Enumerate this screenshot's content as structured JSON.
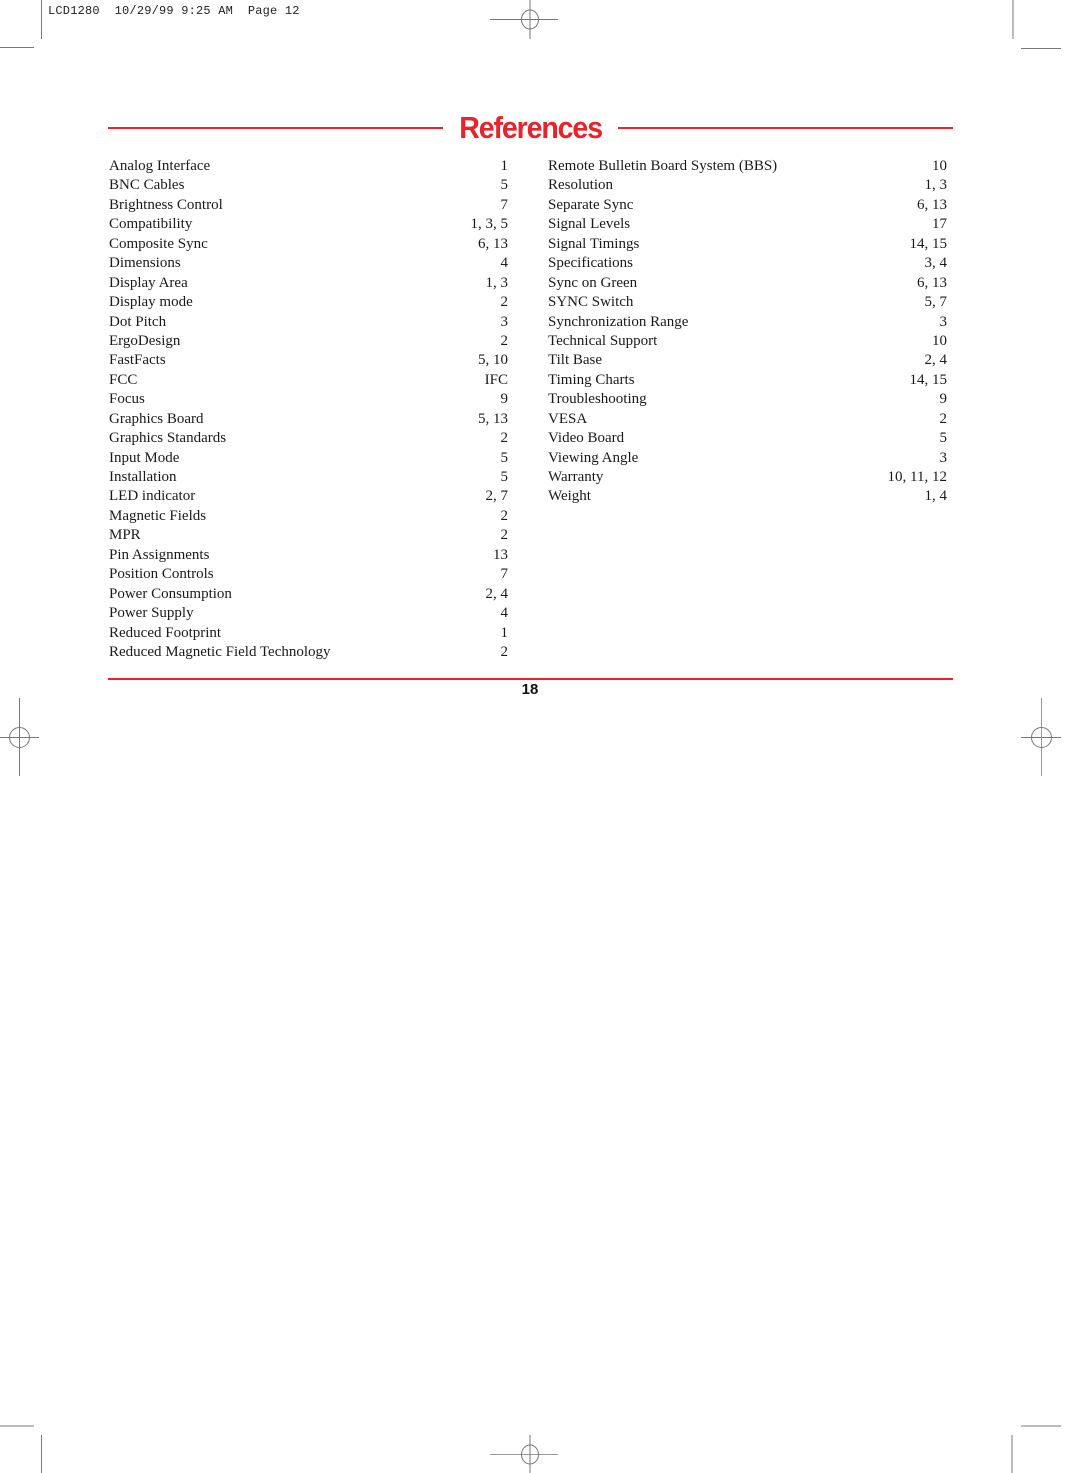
{
  "slug": "LCD1280  10/29/99 9:25 AM  Page 12",
  "title": "References",
  "page_number": "18",
  "accent_color": "#e8232a",
  "left_column": [
    {
      "term": "Analog Interface",
      "pages": "1"
    },
    {
      "term": "BNC Cables",
      "pages": "5"
    },
    {
      "term": "Brightness Control",
      "pages": "7"
    },
    {
      "term": "Compatibility",
      "pages": "1, 3, 5"
    },
    {
      "term": "Composite Sync",
      "pages": "6, 13"
    },
    {
      "term": "Dimensions",
      "pages": "4"
    },
    {
      "term": "Display Area",
      "pages": "1, 3"
    },
    {
      "term": "Display mode",
      "pages": "2"
    },
    {
      "term": "Dot Pitch",
      "pages": "3"
    },
    {
      "term": "ErgoDesign",
      "pages": "2"
    },
    {
      "term": "FastFacts",
      "pages": "5, 10"
    },
    {
      "term": "FCC",
      "pages": "IFC"
    },
    {
      "term": "Focus",
      "pages": "9"
    },
    {
      "term": "Graphics Board",
      "pages": "5, 13"
    },
    {
      "term": "Graphics Standards",
      "pages": "2"
    },
    {
      "term": "Input Mode",
      "pages": "5"
    },
    {
      "term": "Installation",
      "pages": "5"
    },
    {
      "term": "LED indicator",
      "pages": "2, 7"
    },
    {
      "term": "Magnetic Fields",
      "pages": "2"
    },
    {
      "term": "MPR",
      "pages": "2"
    },
    {
      "term": "Pin Assignments",
      "pages": "13"
    },
    {
      "term": "Position Controls",
      "pages": "7"
    },
    {
      "term": "Power Consumption",
      "pages": "2, 4"
    },
    {
      "term": "Power Supply",
      "pages": "4"
    },
    {
      "term": "Reduced Footprint",
      "pages": "1"
    },
    {
      "term": "Reduced Magnetic Field Technology",
      "pages": "2"
    }
  ],
  "right_column": [
    {
      "term": "Remote Bulletin Board System (BBS)",
      "pages": "10"
    },
    {
      "term": "Resolution",
      "pages": "1, 3"
    },
    {
      "term": "Separate Sync",
      "pages": "6, 13"
    },
    {
      "term": "Signal Levels",
      "pages": "17"
    },
    {
      "term": "Signal Timings",
      "pages": "14, 15"
    },
    {
      "term": "Specifications",
      "pages": "3, 4"
    },
    {
      "term": "Sync on Green",
      "pages": "6, 13"
    },
    {
      "term": "SYNC Switch",
      "pages": "5, 7"
    },
    {
      "term": "Synchronization Range",
      "pages": "3"
    },
    {
      "term": "Technical Support",
      "pages": "10"
    },
    {
      "term": "Tilt Base",
      "pages": "2, 4"
    },
    {
      "term": "Timing Charts",
      "pages": "14, 15"
    },
    {
      "term": "Troubleshooting",
      "pages": "9"
    },
    {
      "term": "VESA",
      "pages": "2"
    },
    {
      "term": "Video Board",
      "pages": "5"
    },
    {
      "term": "Viewing Angle",
      "pages": "3"
    },
    {
      "term": "Warranty",
      "pages": "10, 11, 12"
    },
    {
      "term": "Weight",
      "pages": "1, 4"
    }
  ]
}
